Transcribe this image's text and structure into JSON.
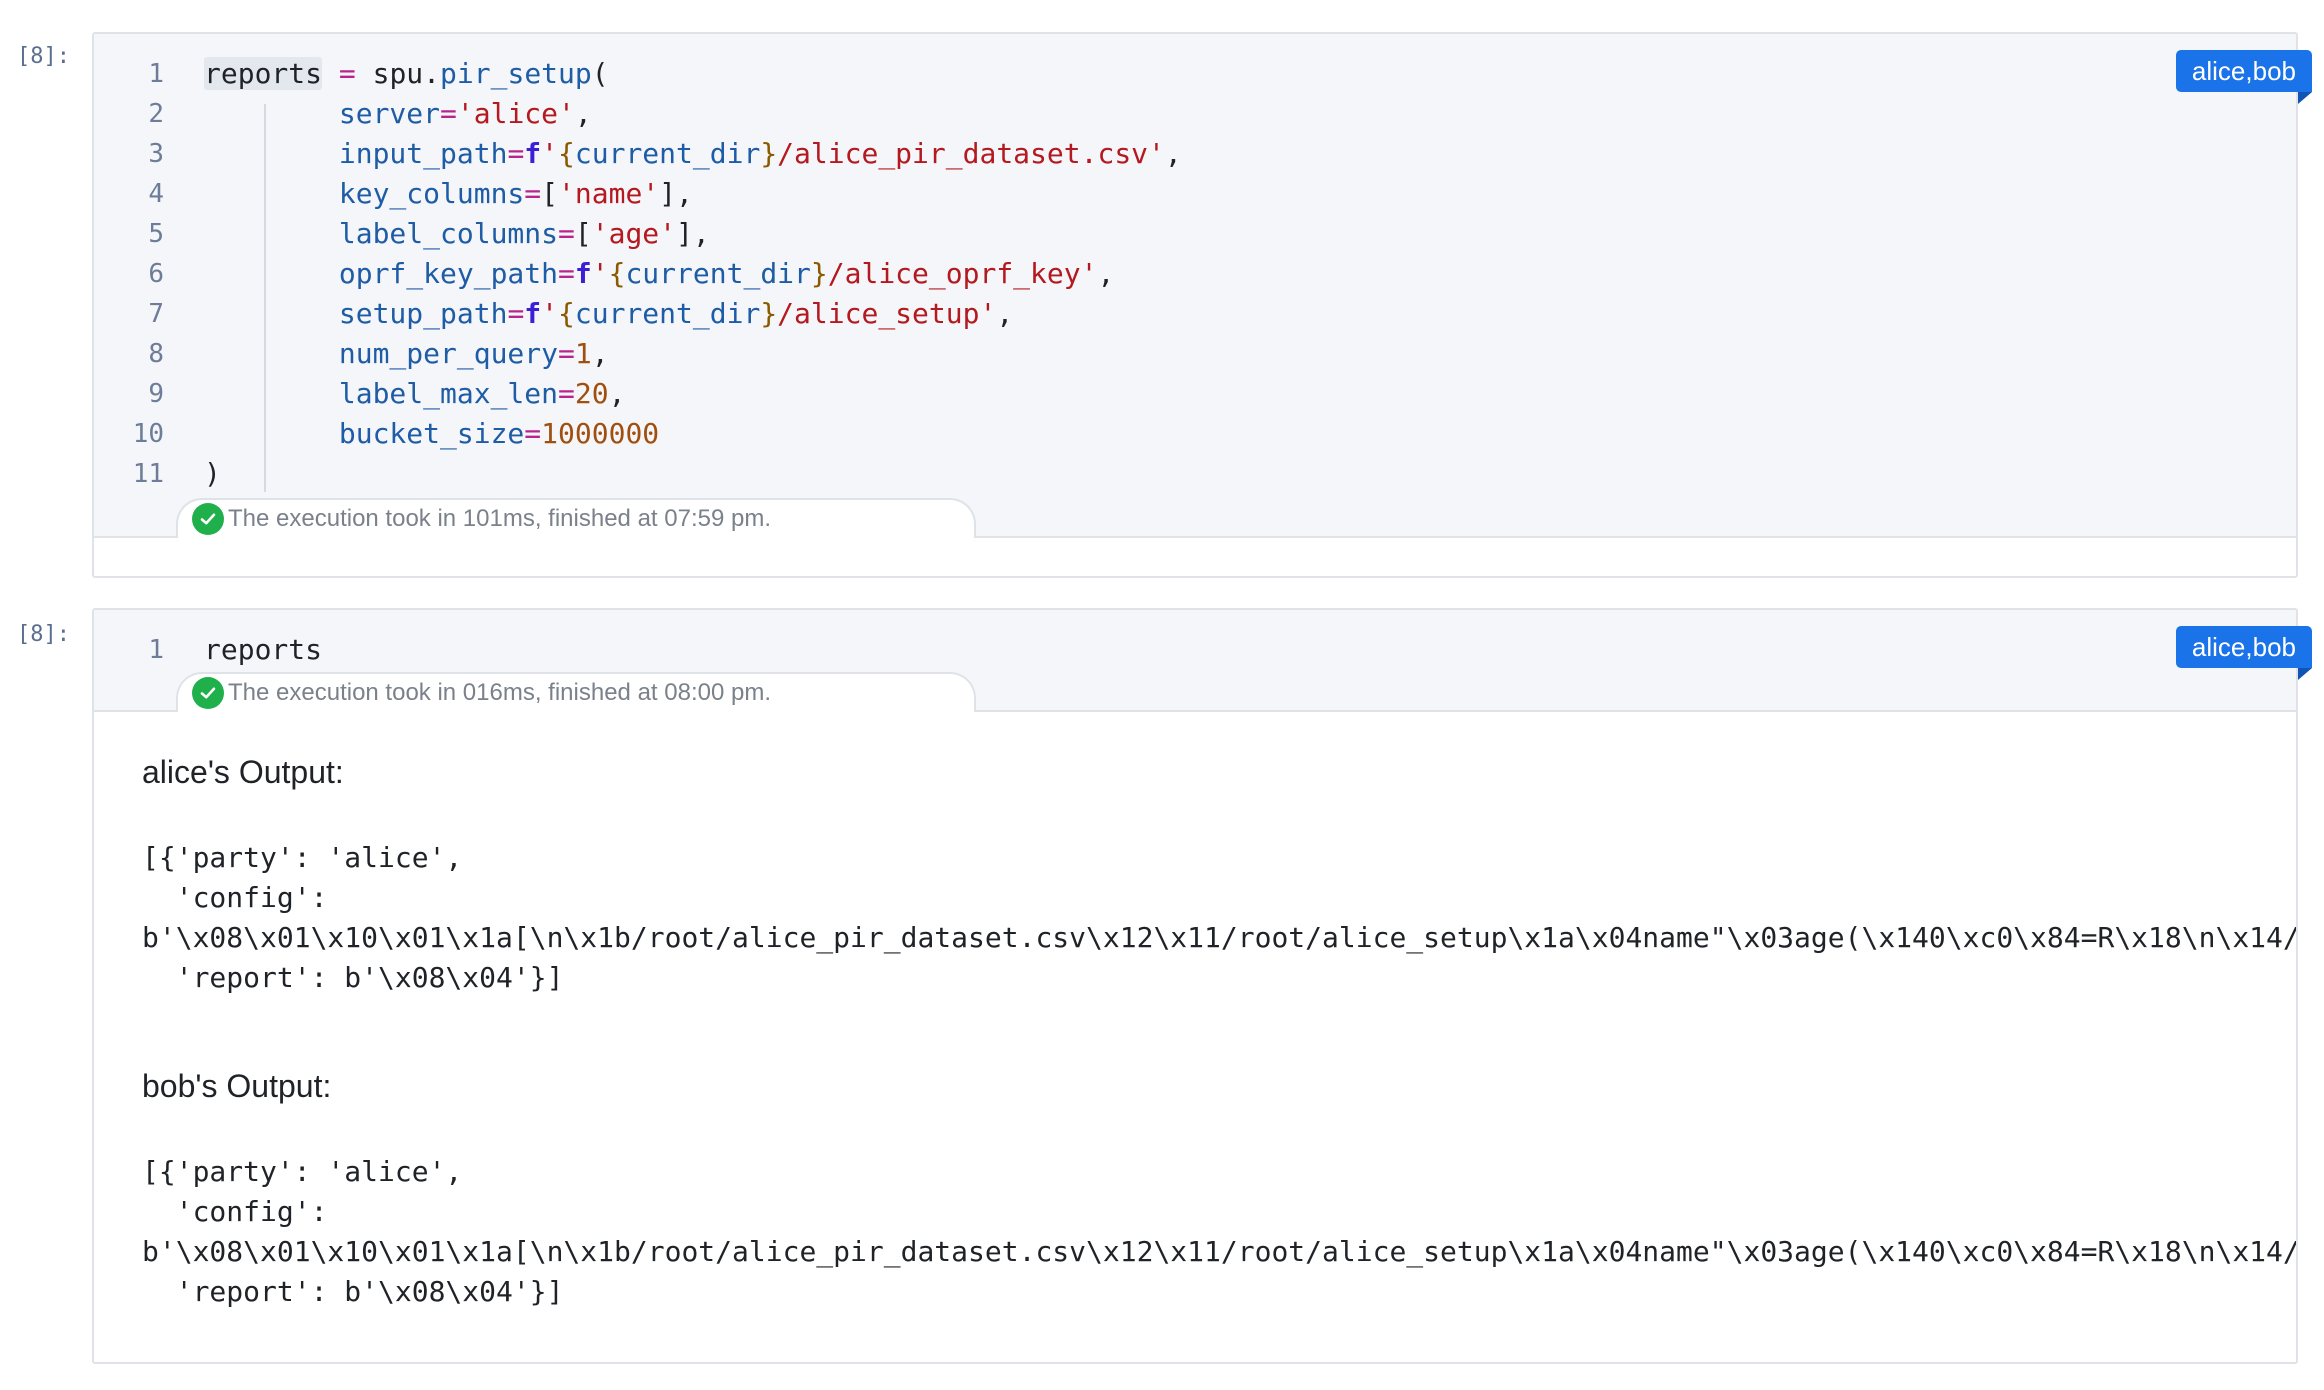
{
  "cells": [
    {
      "prompt": "[8]:",
      "tag": "alice,bob",
      "execution": "The execution took in 101ms, finished at 07:59 pm.",
      "lines": [
        {
          "n": "1",
          "t": [
            [
              "hl",
              "reports"
            ],
            [
              "var",
              " "
            ],
            [
              "op",
              "="
            ],
            [
              "var",
              " spu."
            ],
            [
              "fn",
              "pir_setup"
            ],
            [
              "punc",
              "("
            ]
          ]
        },
        {
          "n": "2",
          "t": [
            [
              "var",
              "        "
            ],
            [
              "param",
              "server"
            ],
            [
              "op",
              "="
            ],
            [
              "str",
              "'alice'"
            ],
            [
              "punc",
              ","
            ]
          ]
        },
        {
          "n": "3",
          "t": [
            [
              "var",
              "        "
            ],
            [
              "param",
              "input_path"
            ],
            [
              "op",
              "="
            ],
            [
              "f",
              "f"
            ],
            [
              "str",
              "'"
            ],
            [
              "brace",
              "{"
            ],
            [
              "param",
              "current_dir"
            ],
            [
              "brace",
              "}"
            ],
            [
              "str",
              "/alice_pir_dataset.csv'"
            ],
            [
              "punc",
              ","
            ]
          ]
        },
        {
          "n": "4",
          "t": [
            [
              "var",
              "        "
            ],
            [
              "param",
              "key_columns"
            ],
            [
              "op",
              "="
            ],
            [
              "punc",
              "["
            ],
            [
              "str",
              "'name'"
            ],
            [
              "punc",
              "],"
            ]
          ]
        },
        {
          "n": "5",
          "t": [
            [
              "var",
              "        "
            ],
            [
              "param",
              "label_columns"
            ],
            [
              "op",
              "="
            ],
            [
              "punc",
              "["
            ],
            [
              "str",
              "'age'"
            ],
            [
              "punc",
              "],"
            ]
          ]
        },
        {
          "n": "6",
          "t": [
            [
              "var",
              "        "
            ],
            [
              "param",
              "oprf_key_path"
            ],
            [
              "op",
              "="
            ],
            [
              "f",
              "f"
            ],
            [
              "str",
              "'"
            ],
            [
              "brace",
              "{"
            ],
            [
              "param",
              "current_dir"
            ],
            [
              "brace",
              "}"
            ],
            [
              "str",
              "/alice_oprf_key'"
            ],
            [
              "punc",
              ","
            ]
          ]
        },
        {
          "n": "7",
          "t": [
            [
              "var",
              "        "
            ],
            [
              "param",
              "setup_path"
            ],
            [
              "op",
              "="
            ],
            [
              "f",
              "f"
            ],
            [
              "str",
              "'"
            ],
            [
              "brace",
              "{"
            ],
            [
              "param",
              "current_dir"
            ],
            [
              "brace",
              "}"
            ],
            [
              "str",
              "/alice_setup'"
            ],
            [
              "punc",
              ","
            ]
          ]
        },
        {
          "n": "8",
          "t": [
            [
              "var",
              "        "
            ],
            [
              "param",
              "num_per_query"
            ],
            [
              "op",
              "="
            ],
            [
              "num",
              "1"
            ],
            [
              "punc",
              ","
            ]
          ]
        },
        {
          "n": "9",
          "t": [
            [
              "var",
              "        "
            ],
            [
              "param",
              "label_max_len"
            ],
            [
              "op",
              "="
            ],
            [
              "num",
              "20"
            ],
            [
              "punc",
              ","
            ]
          ]
        },
        {
          "n": "10",
          "t": [
            [
              "var",
              "        "
            ],
            [
              "param",
              "bucket_size"
            ],
            [
              "op",
              "="
            ],
            [
              "num",
              "1000000"
            ]
          ]
        },
        {
          "n": "11",
          "t": [
            [
              "punc",
              ")"
            ]
          ]
        }
      ]
    },
    {
      "prompt": "[8]:",
      "tag": "alice,bob",
      "execution": "The execution took in 016ms, finished at 08:00 pm.",
      "lines": [
        {
          "n": "1",
          "t": [
            [
              "var",
              "reports"
            ]
          ]
        }
      ],
      "outputs": [
        {
          "title": "alice's Output:",
          "text": "[{'party': 'alice',\n  'config':\nb'\\x08\\x01\\x10\\x01\\x1a[\\n\\x1b/root/alice_pir_dataset.csv\\x12\\x11/root/alice_setup\\x1a\\x04name\"\\x03age(\\x140\\xc0\\x84=R\\x18\\n\\x14/\n  'report': b'\\x08\\x04'}]"
        },
        {
          "title": "bob's Output:",
          "text": "[{'party': 'alice',\n  'config':\nb'\\x08\\x01\\x10\\x01\\x1a[\\n\\x1b/root/alice_pir_dataset.csv\\x12\\x11/root/alice_setup\\x1a\\x04name\"\\x03age(\\x140\\xc0\\x84=R\\x18\\n\\x14/\n  'report': b'\\x08\\x04'}]"
        }
      ]
    }
  ]
}
